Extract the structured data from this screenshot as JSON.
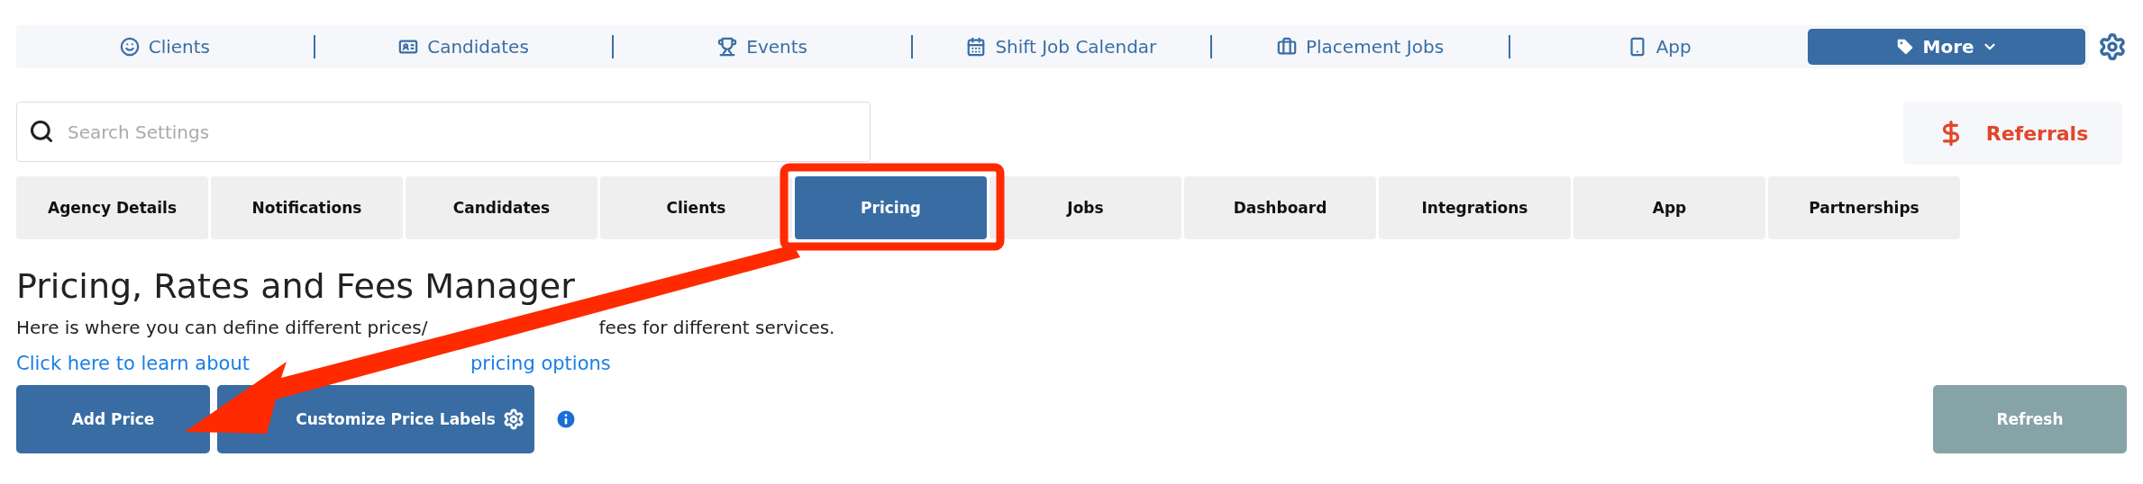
{
  "nav": {
    "items": [
      {
        "label": "Clients"
      },
      {
        "label": "Candidates"
      },
      {
        "label": "Events"
      },
      {
        "label": "Shift Job Calendar"
      },
      {
        "label": "Placement Jobs"
      },
      {
        "label": "App"
      }
    ],
    "more": {
      "label": "More"
    }
  },
  "search": {
    "placeholder": "Search Settings"
  },
  "referrals": {
    "label": "Referrals"
  },
  "tabs": [
    {
      "label": "Agency Details",
      "selected": false
    },
    {
      "label": "Notifications",
      "selected": false
    },
    {
      "label": "Candidates",
      "selected": false
    },
    {
      "label": "Clients",
      "selected": false
    },
    {
      "label": "Pricing",
      "selected": true
    },
    {
      "label": "Jobs",
      "selected": false
    },
    {
      "label": "Dashboard",
      "selected": false
    },
    {
      "label": "Integrations",
      "selected": false
    },
    {
      "label": "App",
      "selected": false
    },
    {
      "label": "Partnerships",
      "selected": false
    }
  ],
  "heading": "Pricing, Rates and Fees Manager",
  "description": [
    "Here is where you can define different prices/",
    "fees for different services."
  ],
  "help_link": [
    "Click here to learn about",
    "pricing options"
  ],
  "buttons": {
    "add": "Add Price",
    "customize": "Customize Price Labels",
    "refresh": "Refresh"
  }
}
